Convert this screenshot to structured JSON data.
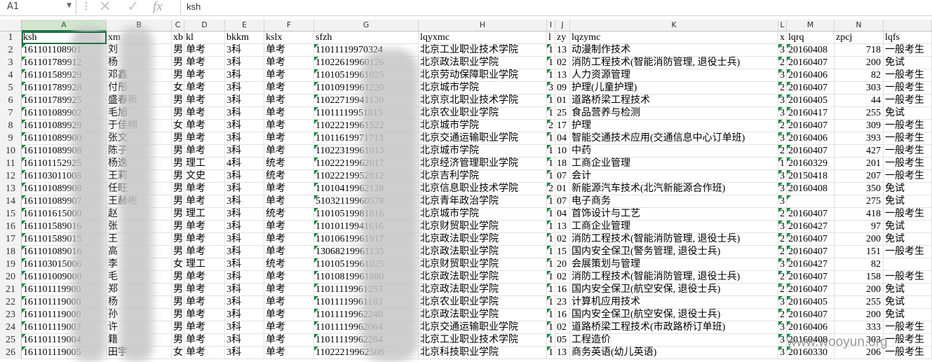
{
  "formula_bar": {
    "name_box": "A1",
    "formula": "ksh",
    "icons": [
      "dropdown-icon",
      "more-dots-icon",
      "cancel-icon",
      "enter-icon",
      "function-icon"
    ]
  },
  "columns": [
    "A",
    "B",
    "C",
    "D",
    "E",
    "F",
    "G",
    "H",
    "I",
    "J",
    "K",
    "L",
    "M",
    "N",
    ""
  ],
  "header_row": [
    "ksh",
    "xm",
    "xb",
    "kl",
    "bkkm",
    "kslx",
    "sfzh",
    "lqyxmc",
    "l",
    "zy",
    "lqzymc",
    "x",
    "lqrq",
    "zpcj",
    "lqfs"
  ],
  "rows": [
    [
      "161101108901",
      "刘",
      "男",
      "单考",
      "3科",
      "单考",
      "11011119970324",
      "北京工业职业技术学院",
      "1",
      "13",
      "动漫制作技术",
      "3",
      "20160408",
      "718",
      "一般考生"
    ],
    [
      "161101789912",
      "杨",
      "男",
      "单考",
      "3科",
      "单考",
      "11022619960126",
      "北京政法职业学院",
      "1",
      "02",
      "消防工程技术(智能消防管理, 退役士兵)",
      "2",
      "20160407",
      "200",
      "免试"
    ],
    [
      "161101589929",
      "邓鑫",
      "男",
      "单考",
      "3科",
      "单考",
      "11010519961025",
      "北京劳动保障职业学院",
      "1",
      "13",
      "人力资源管理",
      "3",
      "20160406",
      "82",
      "一般考生"
    ],
    [
      "161101789928",
      "付彤",
      "女",
      "单考",
      "3科",
      "单考",
      "11010919961220",
      "北京城市学院",
      "3",
      "09",
      "护理(儿童护理)",
      "2",
      "20160407",
      "303",
      "一般考生"
    ],
    [
      "161101789925",
      "盛春新",
      "男",
      "单考",
      "3科",
      "单考",
      "11022719941120",
      "北京京北职业技术学院",
      "1",
      "01",
      "道路桥梁工程技术",
      "3",
      "20160405",
      "44",
      "一般考生"
    ],
    [
      "161101089902",
      "毛旭",
      "男",
      "单考",
      "3科",
      "单考",
      "11011119951815",
      "北京农业职业学院",
      "1",
      "25",
      "食品营养与检测",
      "3",
      "20160417",
      "255",
      "免试"
    ],
    [
      "161101089929",
      "于佳楠",
      "女",
      "单考",
      "3科",
      "单考",
      "11022219961522",
      "北京城市学院",
      "2",
      "17",
      "护理",
      "2",
      "20160407",
      "309",
      "一般考生"
    ],
    [
      "161101089900",
      "张文",
      "男",
      "单考",
      "3科",
      "单考",
      "11011619971713",
      "北京交通运输职业学院",
      "1",
      "04",
      "智能交通技术应用(交通信息中心订单班)",
      "3",
      "20160406",
      "393",
      "一般考生"
    ],
    [
      "161101089908",
      "陈子",
      "男",
      "单考",
      "3科",
      "单考",
      "11022319961013",
      "北京城市学院",
      "1",
      "10",
      "中药",
      "2",
      "20160407",
      "427",
      "一般考生"
    ],
    [
      "161101152925",
      "杨逸",
      "男",
      "理工",
      "4科",
      "统考",
      "11022219962017",
      "北京经济管理职业学院",
      "1",
      "18",
      "工商企业管理",
      "1",
      "20160329",
      "201",
      "一般考生"
    ],
    [
      "161103011008",
      "王莉",
      "男",
      "文史",
      "3科",
      "统考",
      "11022219952812",
      "北京吉利学院",
      "1",
      "07",
      "会计",
      "3",
      "20150418",
      "207",
      "一般考生"
    ],
    [
      "161101089908",
      "任旺",
      "男",
      "单考",
      "3科",
      "单考",
      "11010419962128",
      "北京信息职业技术学院",
      "2",
      "01",
      "新能源汽车技术(北汽新能源合作班)",
      "3",
      "20160408",
      "350",
      "免试"
    ],
    [
      "161101089907",
      "王赫彬",
      "男",
      "单考",
      "3科",
      "单考",
      "51032119960578",
      "北京青年政治学院",
      "1",
      "07",
      "电子商务",
      "3",
      "",
      "275",
      "免试"
    ],
    [
      "161101615000",
      "赵",
      "男",
      "理工",
      "3科",
      "统考",
      "11010519981816",
      "北京城市学院",
      "1",
      "04",
      "首饰设计与工艺",
      "2",
      "20160407",
      "418",
      "一般考生"
    ],
    [
      "161101589016",
      "张",
      "男",
      "单考",
      "3科",
      "单考",
      "11010119941616",
      "北京财贸职业学院",
      "1",
      "13",
      "工商企业管理",
      "3",
      "20160427",
      "97",
      "免试"
    ],
    [
      "161101589015",
      "王",
      "男",
      "单考",
      "3科",
      "单考",
      "11010619961917",
      "北京政法职业学院",
      "1",
      "02",
      "消防工程技术(智能消防管理, 退役士兵)",
      "2",
      "20160407",
      "200",
      "免试"
    ],
    [
      "161101089016",
      "高",
      "男",
      "单考",
      "3科",
      "单考",
      "13068219961135",
      "北京政法职业学院",
      "1",
      "15",
      "国内安全保卫(警务管理, 退役士兵)",
      "2",
      "20160407",
      "151",
      "一般考生"
    ],
    [
      "161103015006",
      "李",
      "女",
      "理工",
      "3科",
      "统考",
      "11010519961025",
      "北京财贸职业学院",
      "1",
      "20",
      "会展策划与管理",
      "3",
      "20160427",
      "82",
      ""
    ],
    [
      "161101009000",
      "毛",
      "男",
      "单考",
      "3科",
      "单考",
      "11010819961880",
      "北京政法职业学院",
      "1",
      "02",
      "消防工程技术(智能消防管理, 退役士兵)",
      "2",
      "20160407",
      "158",
      "一般考生"
    ],
    [
      "161101119900",
      "郑",
      "男",
      "单考",
      "3科",
      "单考",
      "11011119961253",
      "北京政法职业学院",
      "1",
      "16",
      "国内安全保卫(航空安保, 退役士兵)",
      "2",
      "20160407",
      "200",
      "免试"
    ],
    [
      "161101119000",
      "杨",
      "男",
      "单考",
      "3科",
      "单考",
      "11011119961183",
      "北京农业职业学院",
      "1",
      "23",
      "计算机应用技术",
      "3",
      "20160405",
      "255",
      "免试"
    ],
    [
      "161101119000",
      "孙",
      "男",
      "单考",
      "3科",
      "单考",
      "11011119962240",
      "北京政法职业学院",
      "1",
      "16",
      "国内安全保卫(航空安保, 退役士兵)",
      "2",
      "20160407",
      "200",
      "免试"
    ],
    [
      "161101119003",
      "许",
      "男",
      "单考",
      "3科",
      "单考",
      "11011119962064",
      "北京交通运输职业学院",
      "1",
      "02",
      "道路桥梁工程技术(市政路桥订单班)",
      "3",
      "20160406",
      "333",
      "一般考生"
    ],
    [
      "161101119004",
      "籍",
      "男",
      "单考",
      "3科",
      "单考",
      "11011119962264",
      "北京工业职业技术学院",
      "1",
      "05",
      "工程造价",
      "3",
      "20160408",
      "303",
      "一般考生"
    ],
    [
      "161101119005",
      "田宇",
      "女",
      "单考",
      "3科",
      "单考",
      "11022219962508",
      "北京科技职业学院",
      "1",
      "13",
      "商务英语(幼儿英语)",
      "3",
      "20160330",
      "206",
      "一般考生"
    ]
  ],
  "watermark": "www.wooyun.org"
}
